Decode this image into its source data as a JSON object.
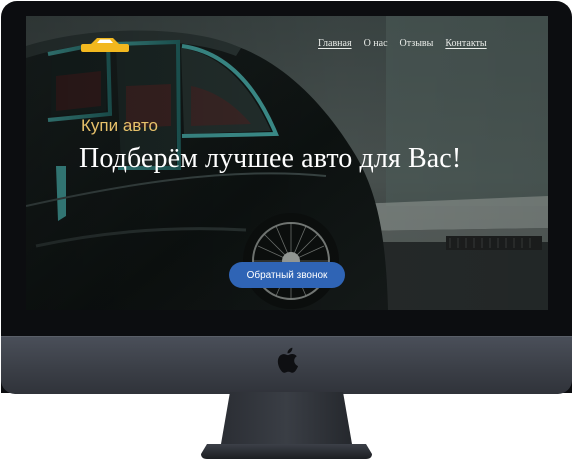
{
  "site": {
    "logo_icon": "car-logo-icon",
    "nav": [
      {
        "label": "Главная",
        "active": true
      },
      {
        "label": "О нас",
        "active": false
      },
      {
        "label": "Отзывы",
        "active": false
      },
      {
        "label": "Контакты",
        "active": false
      }
    ],
    "hero": {
      "subtitle": "Купи авто",
      "headline": "Подберём лучшее авто для Вас!",
      "cta_label": "Обратный звонок"
    }
  },
  "colors": {
    "accent_gold": "#e7c16a",
    "button_blue": "#2f64b5",
    "monitor_chin": "#3b3f47",
    "bezel": "#0c0d10"
  },
  "device": {
    "brand_icon": "apple-icon"
  }
}
